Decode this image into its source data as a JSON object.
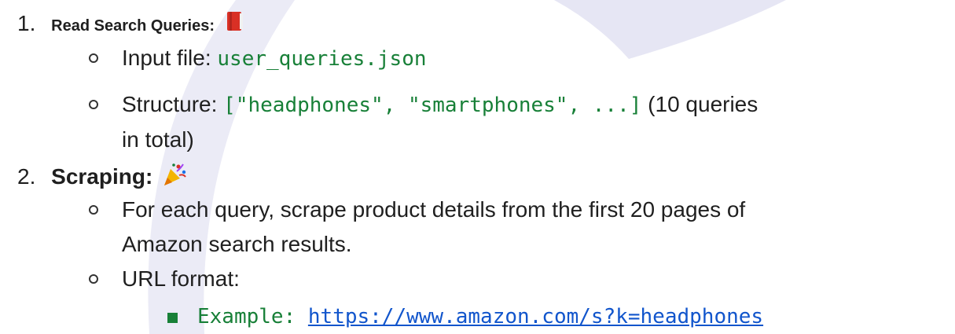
{
  "colors": {
    "text": "#1f1f1f",
    "code": "#188038",
    "link": "#1155cc",
    "watermark": "#e4e5f4"
  },
  "list": {
    "item1": {
      "number": "1.",
      "heading": "Read Search Queries:",
      "icon": "red-book-icon",
      "sub": [
        {
          "label": "Input file: ",
          "code": "user_queries.json"
        },
        {
          "label": "Structure: ",
          "code": "[\"headphones\", \"smartphones\", ...]",
          "after": " (10 queries",
          "continuation": "in total)"
        }
      ]
    },
    "item2": {
      "number": "2.",
      "heading": "Scraping:",
      "icon": "party-popper-icon",
      "sub": [
        {
          "text": "For each query, scrape product details from the first 20 pages of",
          "continuation": "Amazon search results."
        },
        {
          "text": "URL format:"
        }
      ],
      "subsub": {
        "code": "Example: ",
        "link": "https://www.amazon.com/s?k=headphones"
      }
    }
  }
}
